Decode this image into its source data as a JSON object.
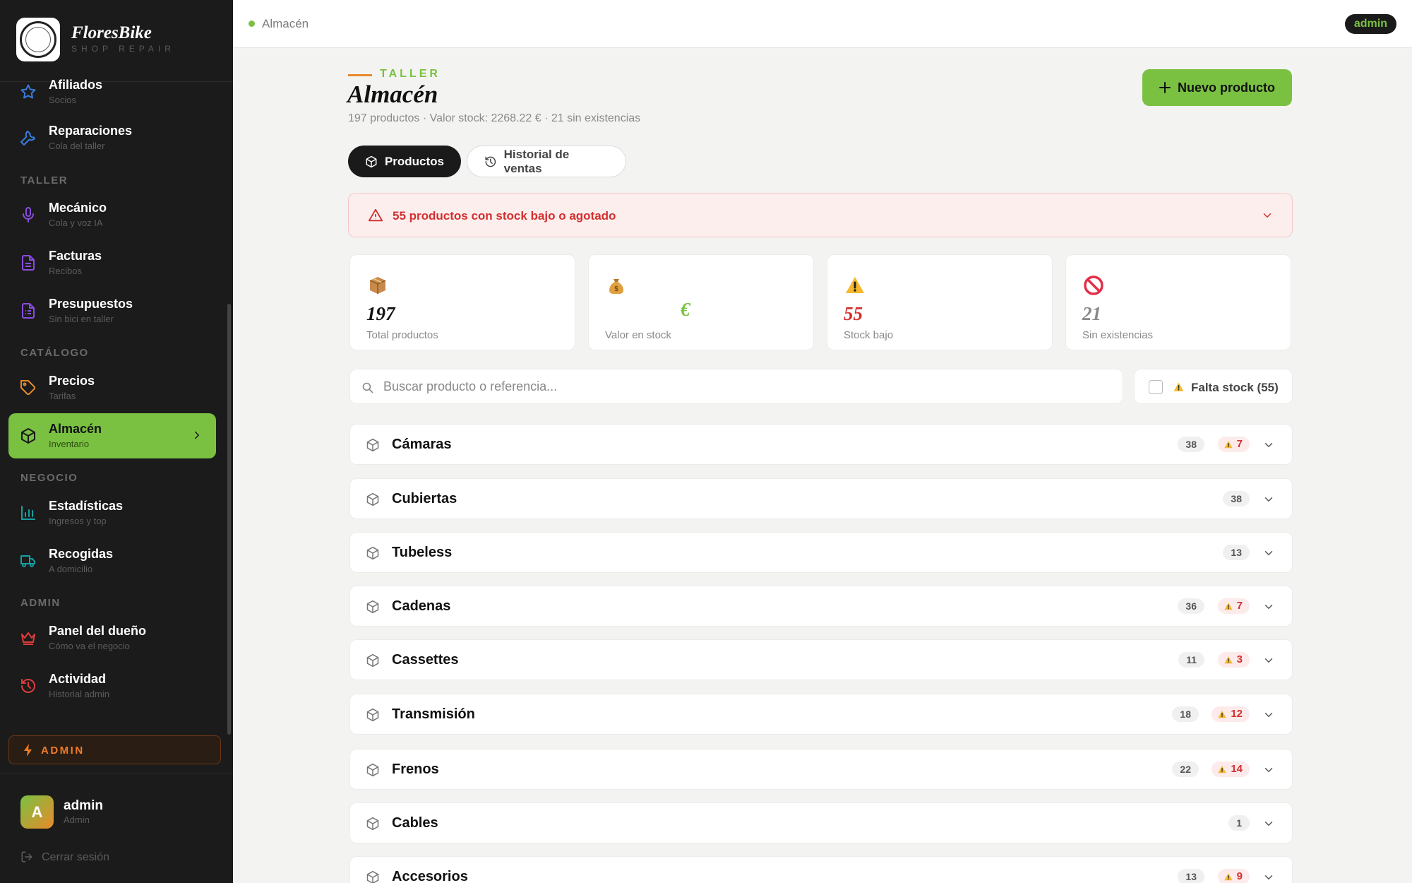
{
  "brand": {
    "name": "FloresBike",
    "sub": "SHOP  REPAIR"
  },
  "sidebar": {
    "items": [
      {
        "key": "afiliados",
        "label": "Afiliados",
        "sub": "Socios",
        "color": "#3b7ddd"
      },
      {
        "key": "reparaciones",
        "label": "Reparaciones",
        "sub": "Cola del taller",
        "color": "#3b7ddd"
      },
      {
        "key": "mecanico",
        "label": "Mecánico",
        "sub": "Cola y voz IA",
        "color": "#8a4de0"
      },
      {
        "key": "facturas",
        "label": "Facturas",
        "sub": "Recibos",
        "color": "#8a4de0"
      },
      {
        "key": "presupuestos",
        "label": "Presupuestos",
        "sub": "Sin bici en taller",
        "color": "#8a4de0"
      },
      {
        "key": "precios",
        "label": "Precios",
        "sub": "Tarifas",
        "color": "#e88a2a"
      },
      {
        "key": "almacen",
        "label": "Almacén",
        "sub": "Inventario",
        "color": "#1a1a1a"
      },
      {
        "key": "estadisticas",
        "label": "Estadísticas",
        "sub": "Ingresos y top",
        "color": "#16a0a0"
      },
      {
        "key": "recogidas",
        "label": "Recogidas",
        "sub": "A domicilio",
        "color": "#16a0a0"
      },
      {
        "key": "panel",
        "label": "Panel del dueño",
        "sub": "Cómo va el negocio",
        "color": "#e03b3b"
      },
      {
        "key": "actividad",
        "label": "Actividad",
        "sub": "Historial admin",
        "color": "#e03b3b"
      }
    ],
    "sections": {
      "taller": "TALLER",
      "catalogo": "CATÁLOGO",
      "negocio": "NEGOCIO",
      "admin": "ADMIN"
    },
    "admin_badge": "ADMIN",
    "user": {
      "initial": "A",
      "name": "admin",
      "role": "Admin"
    },
    "logout": "Cerrar sesión"
  },
  "topbar": {
    "breadcrumb": "Almacén",
    "user_badge": "admin"
  },
  "header": {
    "kicker": "TALLER",
    "title": "Almacén",
    "subtitle": "197 productos · Valor stock: 2268.22 € · 21 sin existencias",
    "new_button": "Nuevo producto"
  },
  "tabs": {
    "productos": "Productos",
    "historial": "Historial de ventas"
  },
  "alert": {
    "text": "55 productos con stock bajo o agotado"
  },
  "stats": [
    {
      "icon": "package-icon",
      "value": "197",
      "label": "Total productos",
      "color": "#111111"
    },
    {
      "icon": "money-bag-icon",
      "value": "€",
      "label": "Valor en stock",
      "color": "#7ac142"
    },
    {
      "icon": "warning-icon",
      "value": "55",
      "label": "Stock bajo",
      "color": "#d32f2f"
    },
    {
      "icon": "prohibited-icon",
      "value": "21",
      "label": "Sin existencias",
      "color": "#888888"
    }
  ],
  "search": {
    "placeholder": "Buscar producto o referencia..."
  },
  "filter": {
    "label": "Falta stock (55)"
  },
  "categories": [
    {
      "name": "Cámaras",
      "count": "38",
      "low": "7"
    },
    {
      "name": "Cubiertas",
      "count": "38",
      "low": ""
    },
    {
      "name": "Tubeless",
      "count": "13",
      "low": ""
    },
    {
      "name": "Cadenas",
      "count": "36",
      "low": "7"
    },
    {
      "name": "Cassettes",
      "count": "11",
      "low": "3"
    },
    {
      "name": "Transmisión",
      "count": "18",
      "low": "12"
    },
    {
      "name": "Frenos",
      "count": "22",
      "low": "14"
    },
    {
      "name": "Cables",
      "count": "1",
      "low": ""
    },
    {
      "name": "Accesorios",
      "count": "13",
      "low": "9"
    }
  ],
  "colors": {
    "accent": "#7ac142",
    "danger": "#d32f2f",
    "sidebar_bg": "#1b1b1b",
    "orange": "#e88a2a"
  }
}
